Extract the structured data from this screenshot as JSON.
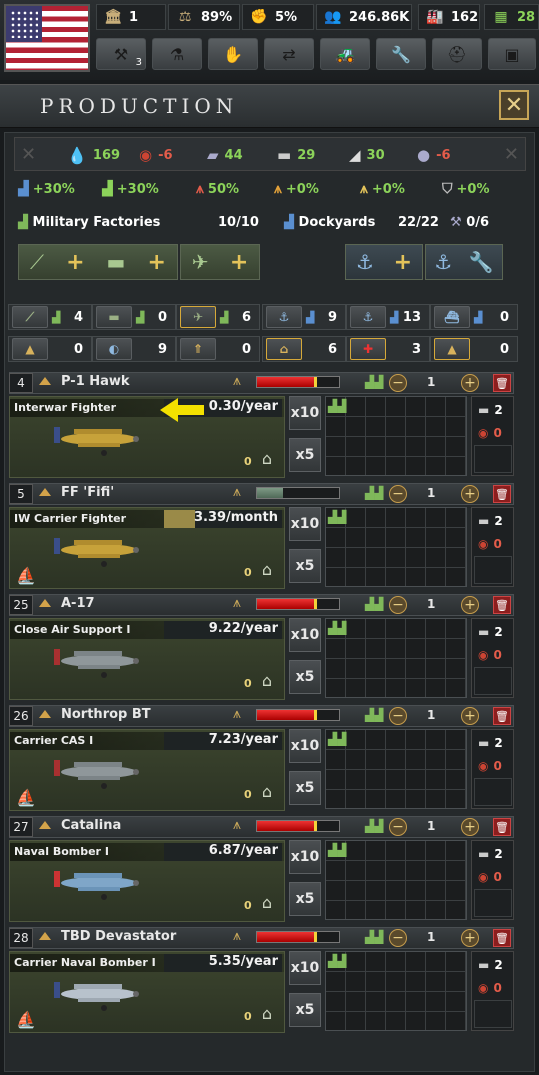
{
  "topbar": {
    "stats": [
      {
        "icon": "political-power-icon",
        "value": "1"
      },
      {
        "icon": "stability-icon",
        "value": "89%"
      },
      {
        "icon": "war-support-icon",
        "value": "5%"
      },
      {
        "icon": "manpower-icon",
        "value": "246.86K"
      },
      {
        "icon": "factories-icon",
        "value": "162"
      },
      {
        "icon": "convoys-icon",
        "value": "28"
      }
    ],
    "menu_buttons": [
      {
        "name": "government-button",
        "count": "3"
      },
      {
        "name": "research-button",
        "count": ""
      },
      {
        "name": "diplomacy-button",
        "count": ""
      },
      {
        "name": "trade-button",
        "count": ""
      },
      {
        "name": "construction-button",
        "count": ""
      },
      {
        "name": "production-button",
        "count": ""
      },
      {
        "name": "recruit-button",
        "count": ""
      },
      {
        "name": "logistics-button",
        "count": ""
      }
    ]
  },
  "window": {
    "title": "PRODUCTION",
    "close_icon": "close-icon"
  },
  "resources": [
    {
      "icon": "oil-icon",
      "value": "169",
      "status": "pos"
    },
    {
      "icon": "rubber-icon",
      "value": "-6",
      "status": "neg"
    },
    {
      "icon": "aluminium-icon",
      "value": "44",
      "status": "pos"
    },
    {
      "icon": "tungsten-icon",
      "value": "29",
      "status": "pos"
    },
    {
      "icon": "steel-icon",
      "value": "30",
      "status": "pos"
    },
    {
      "icon": "chromium-icon",
      "value": "-6",
      "status": "neg"
    }
  ],
  "bonuses": [
    "+30%",
    "+30%",
    "50%",
    "+0%",
    "+0%",
    "+0%"
  ],
  "factories": {
    "military_label": "Military Factories",
    "military_count": "10/10",
    "dockyards_label": "Dockyards",
    "dockyards_count": "22/22",
    "repair_count": "0/6"
  },
  "categories_row1": [
    {
      "name": "land",
      "value": "4"
    },
    {
      "name": "armor",
      "value": "0"
    },
    {
      "name": "air",
      "value": "6"
    },
    {
      "name": "naval-capital",
      "value": "9"
    },
    {
      "name": "naval-screen",
      "value": "13"
    },
    {
      "name": "naval-sub",
      "value": "0"
    }
  ],
  "categories_row2": [
    {
      "name": "support",
      "value": "0"
    },
    {
      "name": "recon",
      "value": "9"
    },
    {
      "name": "artillery",
      "value": "0"
    },
    {
      "name": "transport",
      "value": "6"
    },
    {
      "name": "medical",
      "value": "3"
    },
    {
      "name": "logistics",
      "value": "0"
    }
  ],
  "lines": [
    {
      "priority": "4",
      "name": "P-1 Hawk",
      "equipment": "Interwar Fighter",
      "rate": "0.30/year",
      "factories": "1",
      "needs_a": "2",
      "needs_b": "0",
      "qty": "0",
      "efficiency": 0.72,
      "progress": 0,
      "carrier": false
    },
    {
      "priority": "5",
      "name": "FF 'Fifi'",
      "equipment": "IW Carrier Fighter",
      "rate": "3.39/month",
      "factories": "1",
      "needs_a": "2",
      "needs_b": "0",
      "qty": "0",
      "efficiency": 0.32,
      "progress": 0.26,
      "carrier": true
    },
    {
      "priority": "25",
      "name": "A-17",
      "equipment": "Close Air Support I",
      "rate": "9.22/year",
      "factories": "1",
      "needs_a": "2",
      "needs_b": "0",
      "qty": "0",
      "efficiency": 0.72,
      "progress": 0,
      "carrier": false
    },
    {
      "priority": "26",
      "name": "Northrop BT",
      "equipment": "Carrier CAS I",
      "rate": "7.23/year",
      "factories": "1",
      "needs_a": "2",
      "needs_b": "0",
      "qty": "0",
      "efficiency": 0.72,
      "progress": 0,
      "carrier": true
    },
    {
      "priority": "27",
      "name": "Catalina",
      "equipment": "Naval Bomber I",
      "rate": "6.87/year",
      "factories": "1",
      "needs_a": "2",
      "needs_b": "0",
      "qty": "0",
      "efficiency": 0.72,
      "progress": 0,
      "carrier": false
    },
    {
      "priority": "28",
      "name": "TBD Devastator",
      "equipment": "Carrier Naval Bomber I",
      "rate": "5.35/year",
      "factories": "1",
      "needs_a": "2",
      "needs_b": "0",
      "qty": "0",
      "efficiency": 0.72,
      "progress": 0,
      "carrier": true
    }
  ],
  "colors": {
    "accent": "#c7a557",
    "positive": "#8cd35a",
    "negative": "#e35c4a",
    "bar_red": "#cc2222",
    "bar_marker": "#f3d23a"
  }
}
